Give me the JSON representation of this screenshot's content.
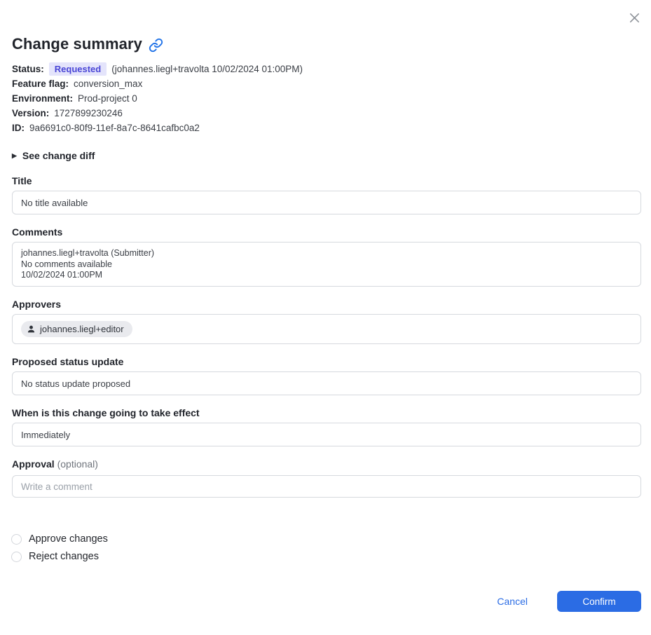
{
  "header": {
    "title": "Change summary"
  },
  "status": {
    "label": "Status:",
    "badge": "Requested",
    "detail": "(johannes.liegl+travolta 10/02/2024 01:00PM)"
  },
  "meta": {
    "feature_flag": {
      "label": "Feature flag:",
      "value": "conversion_max"
    },
    "environment": {
      "label": "Environment:",
      "value": "Prod-project 0"
    },
    "version": {
      "label": "Version:",
      "value": "1727899230246"
    },
    "id": {
      "label": "ID:",
      "value": "9a6691c0-80f9-11ef-8a7c-8641cafbc0a2"
    }
  },
  "diff_toggle": {
    "label": "See change diff"
  },
  "sections": {
    "title": {
      "heading": "Title",
      "value": "No title available"
    },
    "comments": {
      "heading": "Comments",
      "lines": [
        "johannes.liegl+travolta (Submitter)",
        "No comments available",
        "10/02/2024 01:00PM"
      ]
    },
    "approvers": {
      "heading": "Approvers",
      "chip": "johannes.liegl+editor"
    },
    "status_update": {
      "heading": "Proposed status update",
      "value": "No status update proposed"
    },
    "effect": {
      "heading": "When is this change going to take effect",
      "value": "Immediately"
    },
    "approval": {
      "heading": "Approval",
      "optional": "(optional)",
      "placeholder": "Write a comment"
    }
  },
  "choices": {
    "approve": "Approve changes",
    "reject": "Reject changes"
  },
  "footer": {
    "cancel": "Cancel",
    "confirm": "Confirm"
  },
  "icons": {
    "close": "close-icon",
    "link": "link-icon",
    "person": "person-icon",
    "triangle": "chevron-right-icon"
  },
  "colors": {
    "accent_blue": "#2b6ce4",
    "badge_bg": "#e4e4fb",
    "badge_text": "#4a46d6",
    "border_gray": "#d6d9de"
  }
}
